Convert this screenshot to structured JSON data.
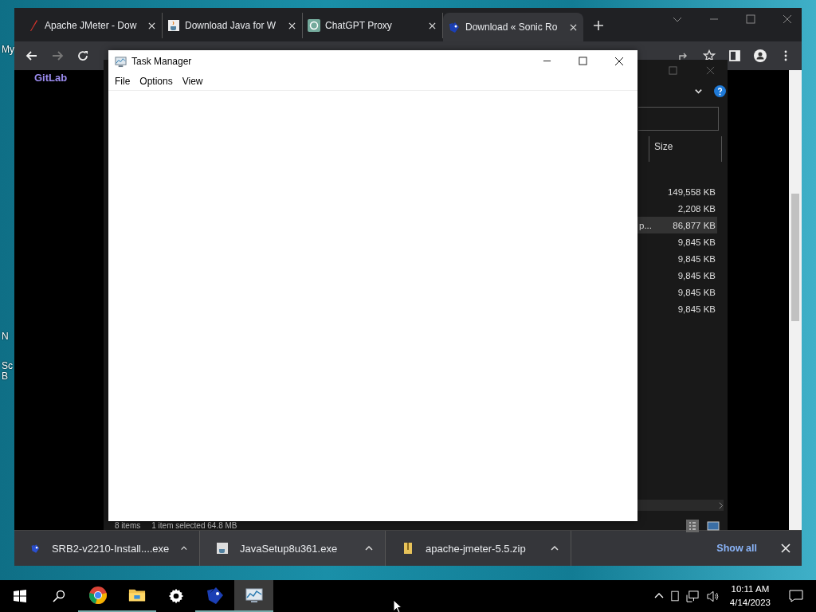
{
  "desktop": {
    "icon_labels": [
      "My",
      "N",
      "Sc",
      "B"
    ]
  },
  "browser": {
    "tabs": [
      {
        "title": "Apache JMeter - Dow",
        "kind": "feather",
        "selected": false
      },
      {
        "title": "Download Java for W",
        "kind": "java",
        "selected": false
      },
      {
        "title": "ChatGPT Proxy",
        "kind": "knot",
        "selected": false
      },
      {
        "title": "Download « Sonic Ro",
        "kind": "sonic",
        "selected": true
      }
    ],
    "forward_disabled": true,
    "page_link": "GitLab"
  },
  "file_explorer": {
    "column": "Size",
    "rows": [
      {
        "size": "149,558 KB",
        "selected": false
      },
      {
        "size": "2,208 KB",
        "selected": false
      },
      {
        "name": "p...",
        "size": "86,877 KB",
        "selected": true
      },
      {
        "size": "9,845 KB",
        "selected": false
      },
      {
        "size": "9,845 KB",
        "selected": false
      },
      {
        "size": "9,845 KB",
        "selected": false
      },
      {
        "size": "9,845 KB",
        "selected": false
      },
      {
        "size": "9,845 KB",
        "selected": false
      }
    ],
    "status": [
      "8 items",
      "1 item selected  64.8 MB"
    ]
  },
  "task_manager": {
    "title": "Task Manager",
    "menu": [
      "File",
      "Options",
      "View"
    ]
  },
  "downloads": {
    "items": [
      {
        "name": "SRB2-v2210-Install....exe",
        "kind": "sonic"
      },
      {
        "name": "JavaSetup8u361.exe",
        "kind": "java"
      },
      {
        "name": "apache-jmeter-5.5.zip",
        "kind": "zip"
      }
    ],
    "show_all": "Show all"
  },
  "taskbar": {
    "apps": [
      {
        "kind": "start",
        "open": false,
        "active": false
      },
      {
        "kind": "search",
        "open": false,
        "active": false
      },
      {
        "kind": "chrome",
        "open": true,
        "active": false
      },
      {
        "kind": "explorer",
        "open": true,
        "active": false
      },
      {
        "kind": "settings",
        "open": false,
        "active": false
      },
      {
        "kind": "sonic",
        "open": true,
        "active": false
      },
      {
        "kind": "taskmgr",
        "open": true,
        "active": true
      }
    ],
    "time": "10:11 AM",
    "date": "4/14/2023"
  }
}
